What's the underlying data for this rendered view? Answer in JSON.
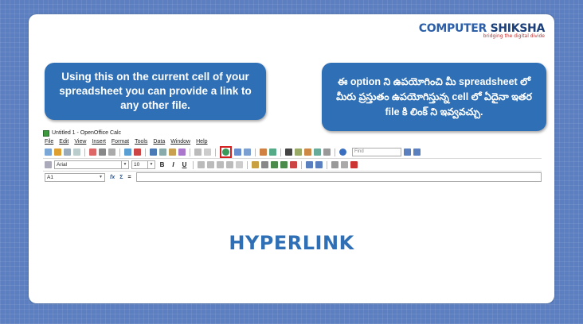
{
  "logo": {
    "part1": "COMPUTER",
    "part2": "SHIKSHA",
    "tagline": "bridging the digital divide"
  },
  "bubble_english": "Using this on the current cell of your spreadsheet you can provide a link to any other file.",
  "bubble_telugu": "ఈ option ని ఉపయోగించి మీ spreadsheet లో మీరు ప్రస్తుతం ఉపయోగిస్తున్న cell లో ఏదైనా ఇతర file కి లింక్ ని ఇవ్వవచ్చు.",
  "calc": {
    "window_title": "Untitled 1 - OpenOffice Calc",
    "menus": [
      "File",
      "Edit",
      "View",
      "Insert",
      "Format",
      "Tools",
      "Data",
      "Window",
      "Help"
    ],
    "find_placeholder": "Find",
    "font_name": "Arial",
    "font_size": "10",
    "bold": "B",
    "italic": "I",
    "underline": "U",
    "cell_ref": "A1",
    "fx_symbol": "fx",
    "sum_symbol": "Σ",
    "equals_symbol": "="
  },
  "main_title": "HYPERLINK",
  "colors": {
    "accent": "#2e6fb5",
    "highlight_box": "#d42020",
    "background": "#5b7fc0"
  }
}
